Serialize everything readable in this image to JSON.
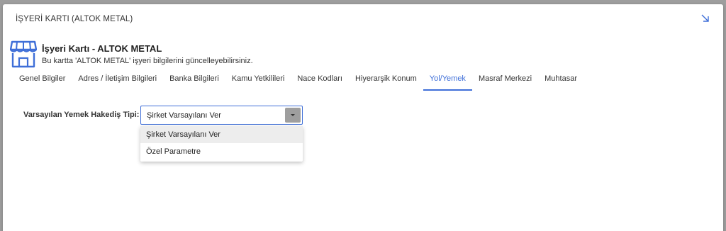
{
  "modal": {
    "title": "İŞYERİ KARTI (ALTOK METAL)"
  },
  "card": {
    "title": "İşyeri Kartı - ALTOK METAL",
    "subtitle": "Bu kartta 'ALTOK METAL' işyeri bilgilerini güncelleyebilirsiniz."
  },
  "tabs": [
    {
      "label": "Genel Bilgiler"
    },
    {
      "label": "Adres / İletişim Bilgileri"
    },
    {
      "label": "Banka Bilgileri"
    },
    {
      "label": "Kamu Yetkilileri"
    },
    {
      "label": "Nace Kodları"
    },
    {
      "label": "Hiyerarşik Konum"
    },
    {
      "label": "Yol/Yemek"
    },
    {
      "label": "Masraf Merkezi"
    },
    {
      "label": "Muhtasar"
    }
  ],
  "active_tab": "Yol/Yemek",
  "form": {
    "meal_type_label": "Varsayılan Yemek Hakediş Tipi:",
    "meal_type_value": "Şirket Varsayılanı Ver",
    "options": [
      {
        "label": "Şirket Varsayılanı Ver"
      },
      {
        "label": "Özel Parametre"
      }
    ]
  },
  "colors": {
    "accent": "#3f6fd8",
    "backdrop": "#9e9e9e"
  },
  "icons": {
    "store": "store-icon",
    "resize": "resize-arrow-icon",
    "caret": "caret-down-icon"
  }
}
